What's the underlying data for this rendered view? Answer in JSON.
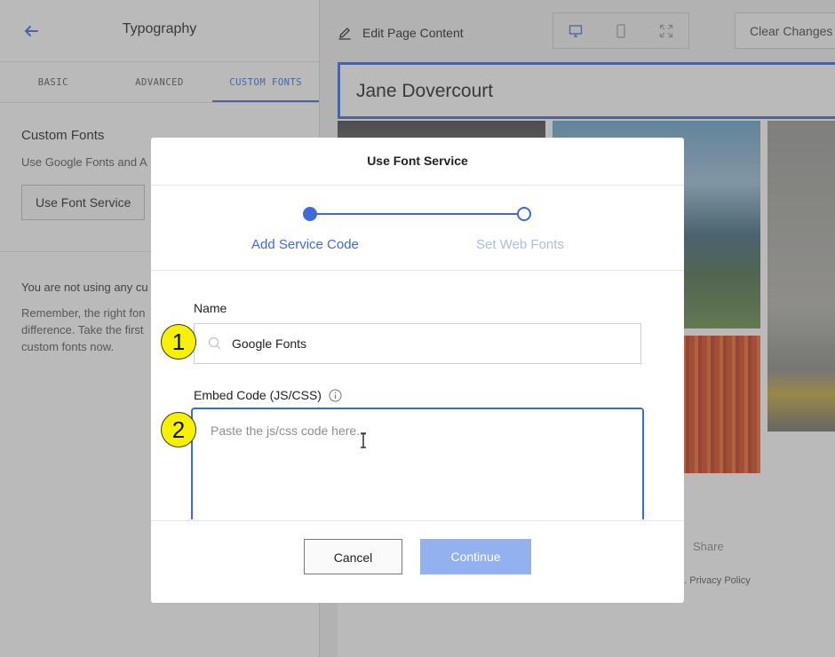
{
  "sidebar": {
    "title": "Typography",
    "tabs": [
      {
        "label": "BASIC"
      },
      {
        "label": "ADVANCED"
      },
      {
        "label": "CUSTOM FONTS",
        "active": true
      }
    ],
    "custom_fonts": {
      "heading": "Custom Fonts",
      "description": "Use Google Fonts and A",
      "button_label": "Use Font Service"
    },
    "note": {
      "line1": "You are not using any cu",
      "line2": "Remember, the right fon",
      "line3": "difference. Take the first",
      "line4": "custom fonts now."
    }
  },
  "toolbar": {
    "edit_label": "Edit Page Content",
    "devices": [
      "desktop-icon",
      "mobile-icon",
      "fullscreen-icon"
    ],
    "clear_label": "Clear Changes"
  },
  "site": {
    "name": "Jane Dovercourt",
    "share_label": "Share",
    "policy_text": "d. Privacy Policy"
  },
  "modal": {
    "title": "Use Font Service",
    "steps": [
      {
        "label": "Add Service Code",
        "state": "active"
      },
      {
        "label": "Set Web Fonts",
        "state": "inactive"
      }
    ],
    "name_label": "Name",
    "name_value": "Google Fonts",
    "embed_label": "Embed Code (JS/CSS)",
    "embed_placeholder": "Paste the js/css code here...",
    "cancel_label": "Cancel",
    "continue_label": "Continue"
  },
  "markers": [
    {
      "number": "1"
    },
    {
      "number": "2"
    }
  ],
  "colors": {
    "accent": "#3e6ad8",
    "accent_light": "#93b0ef",
    "marker": "#f6f100"
  }
}
